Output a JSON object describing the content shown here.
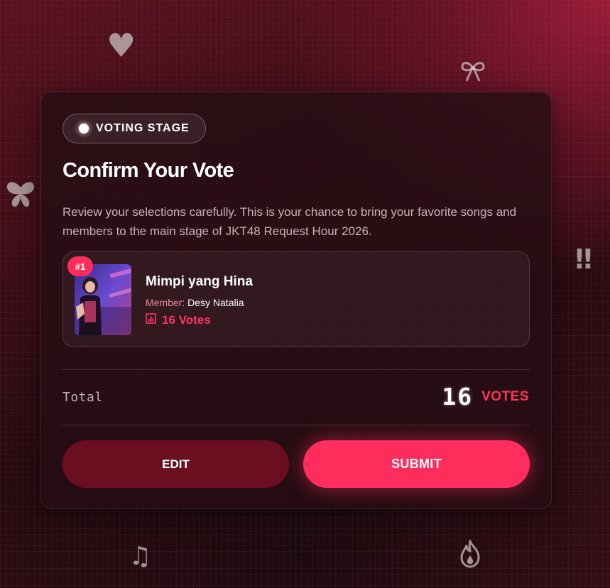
{
  "stage": {
    "label": "VOTING STAGE"
  },
  "confirm": {
    "title": "Confirm Your Vote",
    "description": "Review your selections carefully. This is your chance to bring your favorite songs and members to the main stage of JKT48 Request Hour 2026."
  },
  "selection": {
    "rank": "#1",
    "song": "Mimpi yang Hina",
    "member_prefix": "Member:",
    "member_name": "Desy Natalia",
    "votes": "16 Votes"
  },
  "total": {
    "label": "Total",
    "number": "16",
    "unit": "VOTES"
  },
  "actions": {
    "edit": "EDIT",
    "submit": "SUBMIT"
  },
  "decorations": {
    "heart": "♥",
    "bow": "🎀",
    "exclaim": "‼",
    "note": "♫"
  },
  "colors": {
    "accent": "#ff2d5c",
    "edit_button": "#6a0e20",
    "card": "#260e14"
  },
  "icons": {
    "votes": "bar-chart-icon",
    "live": "white-dot-icon",
    "decor": [
      "pixel-heart-icon",
      "pixel-bow-icon",
      "pixel-butterfly-icon",
      "pixel-exclamation-icon",
      "pixel-music-note-icon",
      "pixel-flame-icon"
    ]
  }
}
